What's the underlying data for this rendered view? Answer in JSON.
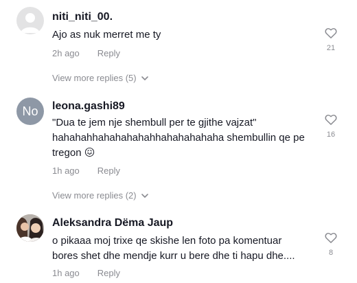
{
  "comments": [
    {
      "username": "niti_niti_00.",
      "text": "Ajo as nuk merret me ty",
      "time": "2h ago",
      "reply": "Reply",
      "likes": "21",
      "avatar_initials": "",
      "avatar_icon": "default-user-icon",
      "view_more": "View more replies (5)"
    },
    {
      "username": "leona.gashi89",
      "text": "\"Dua te jem nje shembull per te gjithe vajzat\"\nhahahahhahahahahahhahahahahaha shembullin qe pe tregon 😖",
      "time": "1h ago",
      "reply": "Reply",
      "likes": "16",
      "avatar_initials": "No",
      "view_more": "View more replies (2)"
    },
    {
      "username": "Aleksandra Dëma Jaup",
      "text": "o pikaaa moj trixe qe skishe len foto pa komentuar\nbores shet dhe mendje kurr u bere dhe ti hapu dhe....",
      "time": "1h ago",
      "reply": "Reply",
      "likes": "8",
      "avatar_initials": "",
      "avatar_icon": "profile-photo"
    }
  ],
  "colors": {
    "muted": "#8a8b91",
    "text": "#161823",
    "generic_avatar": "#e3e3e4",
    "initials_avatar": "#8e98a6"
  }
}
